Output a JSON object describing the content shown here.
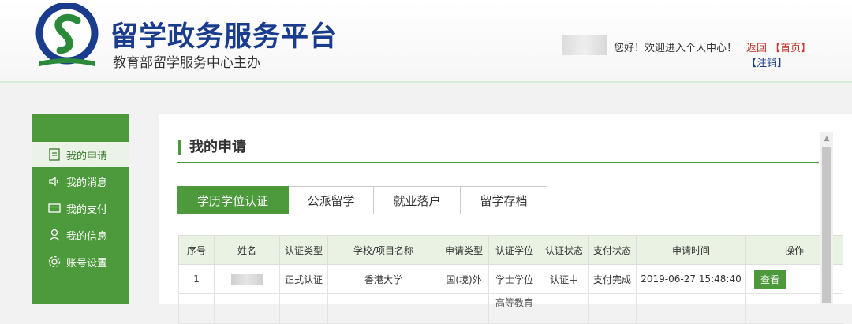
{
  "header": {
    "brand_title": "留学政务服务平台",
    "brand_subtitle": "教育部留学服务中心主办",
    "greeting": "您好！欢迎进入个人中心！",
    "back_link": "返回",
    "home_link": "【首页】",
    "logout_link": "【注销】"
  },
  "sidebar": {
    "items": [
      {
        "label": "我的申请",
        "icon": "document-icon",
        "active": true
      },
      {
        "label": "我的消息",
        "icon": "speaker-icon"
      },
      {
        "label": "我的支付",
        "icon": "card-icon"
      },
      {
        "label": "我的信息",
        "icon": "person-icon"
      },
      {
        "label": "账号设置",
        "icon": "gear-icon"
      }
    ]
  },
  "main": {
    "title": "我的申请",
    "tabs": [
      {
        "label": "学历学位认证",
        "active": true
      },
      {
        "label": "公派留学"
      },
      {
        "label": "就业落户"
      },
      {
        "label": "留学存档"
      }
    ],
    "table": {
      "headers": [
        "序号",
        "姓名",
        "认证类型",
        "学校/项目名称",
        "申请类型",
        "认证学位",
        "认证状态",
        "支付状态",
        "申请时间",
        "操作"
      ],
      "rows": [
        {
          "index": "1",
          "type": "正式认证",
          "school": "香港大学",
          "apply_type": "国(境)外",
          "degree": "学士学位",
          "status": "认证中",
          "pay_status": "支付完成",
          "time": "2019-06-27 15:48:40",
          "action": "查看"
        },
        {
          "degree": "高等教育"
        }
      ]
    }
  },
  "colors": {
    "accent": "#4c9a3c",
    "brand": "#1a3c8c",
    "status_in_progress": "#27a3b8"
  }
}
